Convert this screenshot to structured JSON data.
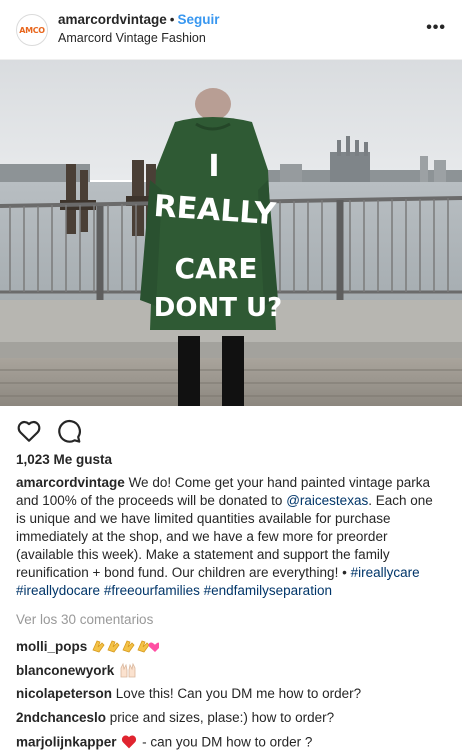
{
  "header": {
    "avatar_text": "AMCO",
    "username": "amarcordvintage",
    "separator": "•",
    "follow_label": "Seguir",
    "subtitle": "Amarcord Vintage Fashion",
    "more_label": "•••"
  },
  "photo": {
    "jacket_text_lines": [
      "I",
      "REALLY",
      "CARE",
      "DONT U?"
    ]
  },
  "actions": {
    "like_icon": "heart-outline-icon",
    "comment_icon": "comment-bubble-icon"
  },
  "likes_text": "1,023 Me gusta",
  "caption": {
    "username": "amarcordvintage",
    "text_before_mention": "We do! Come get your hand painted vintage parka and 100% of the proceeds will be donated to",
    "mention": "@raicestexas",
    "text_after_mention": ". Each one is unique and we have limited quantities available for purchase immediately at the shop, and we have a few more for preorder (available this week). Make a statement and support the family reunification + bond fund. Our children are everything! •",
    "hashtags": [
      "#ireallycare",
      "#ireallydocare",
      "#freeourfamilies",
      "#endfamilyseparation"
    ]
  },
  "view_all_comments": "Ver los 30 comentarios",
  "comments": [
    {
      "user": "molli_pops",
      "text": "",
      "emoji": "clapping-hands-x4-heart"
    },
    {
      "user": "blanconewyork",
      "text": "",
      "emoji": "raised-hands"
    },
    {
      "user": "nicolapeterson",
      "text": "Love this! Can you DM me how to order?"
    },
    {
      "user": "2ndchanceslo",
      "text": "price and sizes, plase:) how to order?"
    },
    {
      "user": "marjolijnkapper",
      "text": "- can you DM how to order ?",
      "emoji": "red-heart"
    }
  ],
  "colors": {
    "link_blue": "#3897f0",
    "hashtag_blue": "#003569",
    "muted_gray": "#999999",
    "jacket_green": "#2f5a34"
  }
}
